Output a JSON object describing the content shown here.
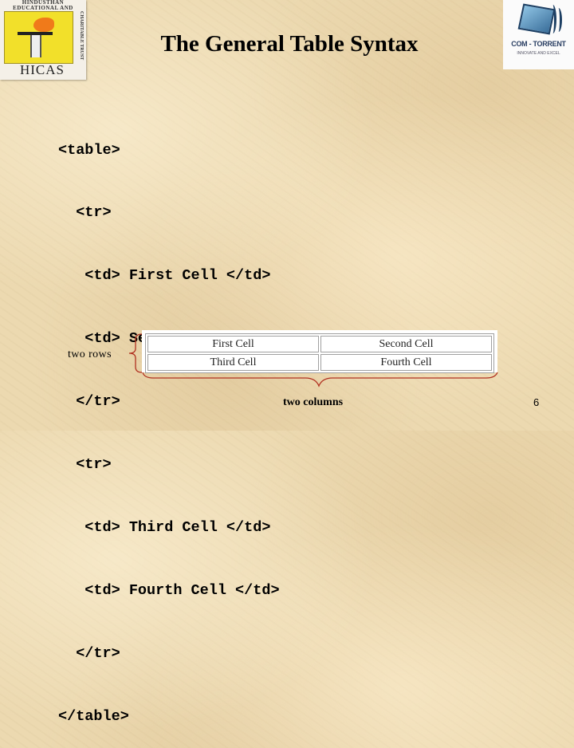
{
  "slide": {
    "title": "The General Table Syntax",
    "page_number": "6"
  },
  "logos": {
    "left": {
      "name": "HICAS",
      "banner_text": "HINDUSTHAN EDUCATIONAL AND",
      "side_text": "CHARITABLE TRUST",
      "colors": {
        "background": "#f2e02a",
        "flame": "#f07a1a"
      }
    },
    "right": {
      "name": "COM - TORRENT",
      "subtitle": "INNOVATE AND EXCEL",
      "colors": {
        "brand": "#2a3f63",
        "screen": "#8fc4e4"
      }
    }
  },
  "code_lines": [
    "<table>",
    "  <tr>",
    "   <td> First Cell </td>",
    "   <td> Second Cell </td>",
    "  </tr>",
    "  <tr>",
    "   <td> Third Cell </td>",
    "   <td> Fourth Cell </td>",
    "  </tr>",
    "</table>"
  ],
  "rendered_table": {
    "rows": [
      [
        "First Cell",
        "Second Cell"
      ],
      [
        "Third Cell",
        "Fourth Cell"
      ]
    ]
  },
  "annotations": {
    "rows_label": "two rows",
    "columns_label": "two columns",
    "brace_color": "#b03020"
  }
}
